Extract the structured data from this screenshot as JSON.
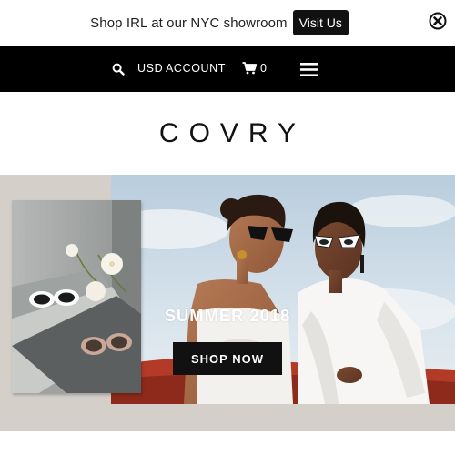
{
  "announcement": {
    "text": "Shop IRL at our NYC showroom",
    "button_label": "Visit Us"
  },
  "nav": {
    "currency": "USD",
    "account": "ACCOUNT",
    "cart_count": "0"
  },
  "brand": {
    "logo": "COVRY"
  },
  "hero": {
    "title": "SUMMER 2018",
    "cta_label": "SHOP NOW"
  },
  "icons": [
    "close-icon",
    "search-icon",
    "cart-icon",
    "hamburger-menu-icon"
  ],
  "colors": {
    "nav_background": "#000000",
    "hero_background": "#d5cfca",
    "button_background": "#111111"
  }
}
